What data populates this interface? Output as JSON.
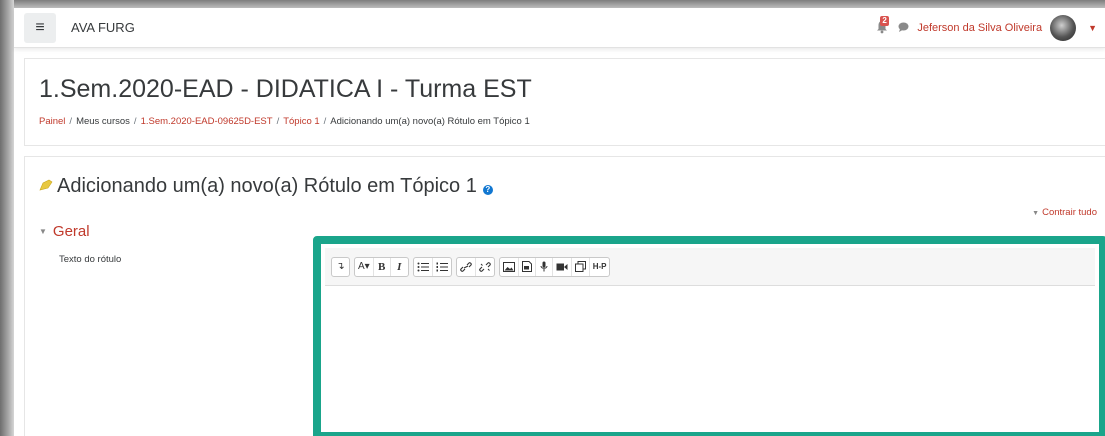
{
  "navbar": {
    "menu_icon": "hamburger-icon",
    "brand": "AVA FURG",
    "notification_count": "2",
    "user_name": "Jeferson da Silva Oliveira"
  },
  "course": {
    "title": "1.Sem.2020-EAD - DIDATICA I - Turma EST",
    "breadcrumb": [
      {
        "label": "Painel",
        "link": true
      },
      {
        "label": "Meus cursos",
        "link": false
      },
      {
        "label": "1.Sem.2020-EAD-09625D-EST",
        "link": true
      },
      {
        "label": "Tópico 1",
        "link": true
      },
      {
        "label": "Adicionando um(a) novo(a) Rótulo em Tópico 1",
        "link": false
      }
    ]
  },
  "form": {
    "heading": "Adicionando um(a) novo(a) Rótulo em Tópico 1",
    "collapse_all": "Contrair tudo",
    "section_general": "Geral",
    "label_text_field": "Texto do rótulo"
  },
  "editor": {
    "toolbar_icons": [
      "collapse-toolbar-icon",
      "font-style-icon",
      "bold-icon",
      "italic-icon",
      "unordered-list-icon",
      "ordered-list-icon",
      "link-icon",
      "unlink-icon",
      "image-icon",
      "media-icon",
      "record-audio-icon",
      "record-video-icon",
      "manage-files-icon",
      "h5p-icon"
    ],
    "style_btn": "A▾",
    "bold_btn": "B",
    "italic_btn": "I",
    "h5p_btn": "H-P"
  },
  "colors": {
    "accent": "#c0392b",
    "highlight": "#1aa58b",
    "help": "#1177d1"
  }
}
